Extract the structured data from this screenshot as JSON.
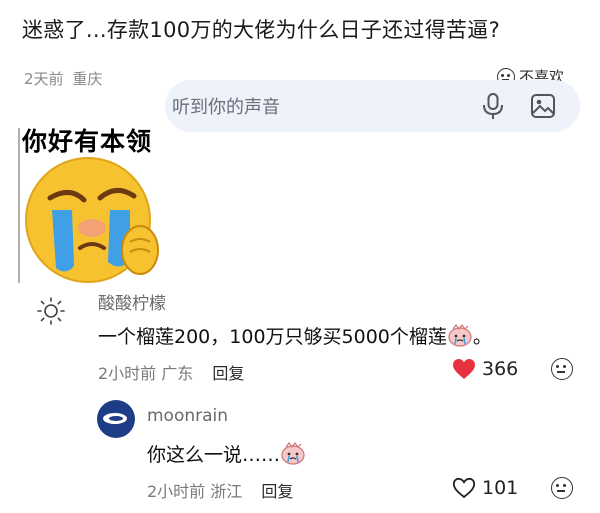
{
  "post": {
    "title": "迷惑了...存款100万的大佬为什么日子还过得苦逼?",
    "time": "2天前",
    "location": "重庆",
    "dislike_label": "不喜欢"
  },
  "sticker": {
    "caption": "你好有本领",
    "voice_hint": "听到你的声音"
  },
  "comments": [
    {
      "user": "酸酸柠檬",
      "text": "一个榴莲200，100万只够买5000个榴莲",
      "text_suffix": "。",
      "time": "2小时前",
      "location": "广东",
      "reply": "回复",
      "likes": "366",
      "liked": true
    },
    {
      "user": "moonrain",
      "text": "你这么一说……",
      "time": "2小时前",
      "location": "浙江",
      "reply": "回复",
      "likes": "101",
      "liked": false
    }
  ],
  "colors": {
    "heart_red": "#e8313f",
    "avatar_blue": "#1d3d86",
    "sticker_yellow": "#f7c230",
    "tear_blue": "#3fa0e6"
  },
  "icons": {
    "dislike": "neutral-face-icon",
    "mic": "microphone-icon",
    "image": "image-icon",
    "like_filled": "heart-filled-icon",
    "like_outline": "heart-outline-icon",
    "more": "neutral-face-icon"
  }
}
